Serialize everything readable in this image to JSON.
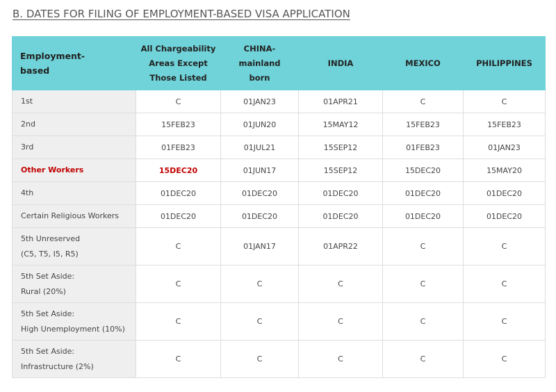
{
  "heading": "B. DATES FOR FILING OF EMPLOYMENT-BASED VISA APPLICATION",
  "header": {
    "col0": [
      "Employment-",
      "based"
    ],
    "col1": [
      "All Chargeability",
      "Areas Except",
      "Those Listed"
    ],
    "col2": [
      "CHINA-",
      "mainland",
      "born"
    ],
    "col3": "INDIA",
    "col4": "MEXICO",
    "col5": "PHILIPPINES"
  },
  "rows": [
    {
      "label": [
        "1st"
      ],
      "values": [
        "C",
        "01JAN23",
        "01APR21",
        "C",
        "C"
      ]
    },
    {
      "label": [
        "2nd"
      ],
      "values": [
        "15FEB23",
        "01JUN20",
        "15MAY12",
        "15FEB23",
        "15FEB23"
      ]
    },
    {
      "label": [
        "3rd"
      ],
      "values": [
        "01FEB23",
        "01JUL21",
        "15SEP12",
        "01FEB23",
        "01JAN23"
      ]
    },
    {
      "label": [
        "Other Workers"
      ],
      "values": [
        "15DEC20",
        "01JUN17",
        "15SEP12",
        "15DEC20",
        "15MAY20"
      ]
    },
    {
      "label": [
        "4th"
      ],
      "values": [
        "01DEC20",
        "01DEC20",
        "01DEC20",
        "01DEC20",
        "01DEC20"
      ]
    },
    {
      "label": [
        "Certain Religious Workers"
      ],
      "values": [
        "01DEC20",
        "01DEC20",
        "01DEC20",
        "01DEC20",
        "01DEC20"
      ]
    },
    {
      "label": [
        "5th Unreserved",
        "(C5, T5, I5, R5)"
      ],
      "values": [
        "C",
        "01JAN17",
        "01APR22",
        "C",
        "C"
      ]
    },
    {
      "label": [
        "5th Set Aside:",
        "Rural (20%)"
      ],
      "values": [
        "C",
        "C",
        "C",
        "C",
        "C"
      ]
    },
    {
      "label": [
        "5th Set Aside:",
        "High Unemployment (10%)"
      ],
      "values": [
        "C",
        "C",
        "C",
        "C",
        "C"
      ]
    },
    {
      "label": [
        "5th Set Aside:",
        "Infrastructure (2%)"
      ],
      "values": [
        "C",
        "C",
        "C",
        "C",
        "C"
      ]
    }
  ],
  "highlight_color": "#c00000",
  "header_color": "#6fd3d9",
  "label_bg_color": "#efefef"
}
